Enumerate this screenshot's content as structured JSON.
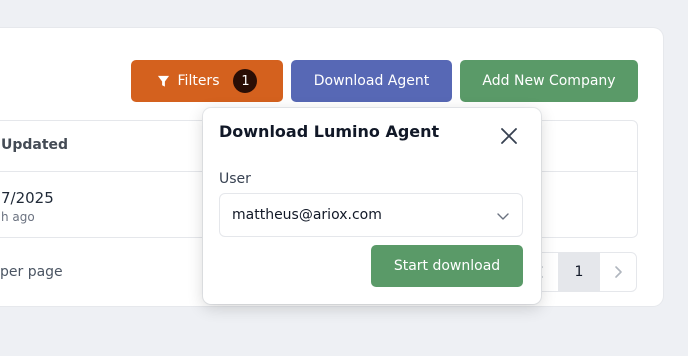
{
  "toolbar": {
    "filters_label": "Filters",
    "filters_count": "1",
    "download_agent_label": "Download Agent",
    "add_company_label": "Add New Company"
  },
  "table": {
    "column_updated": "Updated",
    "row": {
      "date": "7/2025",
      "ago": "h ago"
    }
  },
  "pagination": {
    "per_page_label": "per page",
    "current_page": "1",
    "prev_icon": "chevron-left-icon",
    "next_icon": "chevron-right-icon"
  },
  "modal": {
    "title": "Download Lumino Agent",
    "user_label": "User",
    "user_value": "mattheus@ariox.com",
    "start_label": "Start download"
  },
  "colors": {
    "filters": "#d4611e",
    "download_agent": "#5768b5",
    "add_company": "#5a9a68",
    "start_download": "#5a9a68"
  }
}
